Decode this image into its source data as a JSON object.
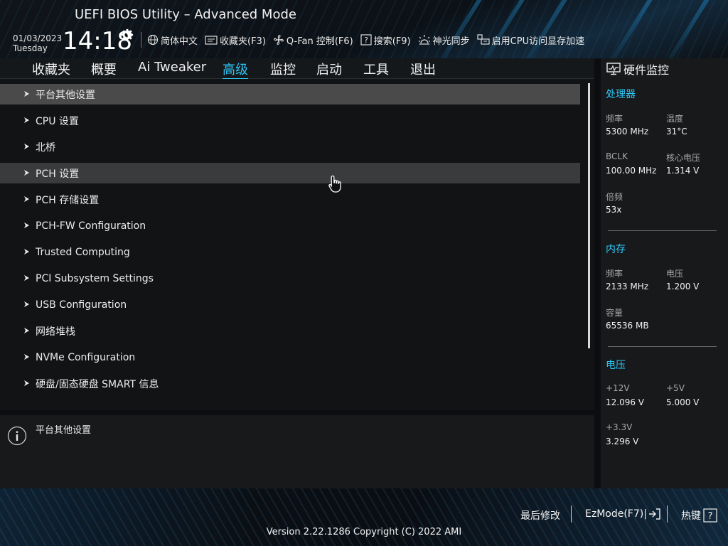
{
  "header": {
    "title": "UEFI BIOS Utility – Advanced Mode",
    "date": "01/03/2023",
    "weekday": "Tuesday",
    "time": "14:18",
    "toolbar": [
      {
        "label": "简体中文",
        "icon": "globe-icon"
      },
      {
        "label": "收藏夹(F3)",
        "icon": "favorites-icon"
      },
      {
        "label": "Q-Fan 控制(F6)",
        "icon": "fan-icon"
      },
      {
        "label": "搜索(F9)",
        "icon": "help-search-icon"
      },
      {
        "label": "神光同步",
        "icon": "aura-icon"
      },
      {
        "label": "启用CPU访问显存加速",
        "icon": "resize-bar-icon"
      }
    ]
  },
  "tabs": [
    {
      "label": "收藏夹",
      "active": false
    },
    {
      "label": "概要",
      "active": false
    },
    {
      "label": "Ai Tweaker",
      "active": false
    },
    {
      "label": "高级",
      "active": true
    },
    {
      "label": "监控",
      "active": false
    },
    {
      "label": "启动",
      "active": false
    },
    {
      "label": "工具",
      "active": false
    },
    {
      "label": "退出",
      "active": false
    }
  ],
  "menu": {
    "items": [
      {
        "label": "平台其他设置"
      },
      {
        "label": "CPU 设置"
      },
      {
        "label": "北桥"
      },
      {
        "label": "PCH 设置"
      },
      {
        "label": "PCH 存储设置"
      },
      {
        "label": "PCH-FW Configuration"
      },
      {
        "label": "Trusted Computing"
      },
      {
        "label": "PCI Subsystem Settings"
      },
      {
        "label": "USB Configuration"
      },
      {
        "label": "网络堆栈"
      },
      {
        "label": "NVMe Configuration"
      },
      {
        "label": "硬盘/固态硬盘 SMART 信息"
      }
    ],
    "selected_index": 0,
    "hover_index": 3
  },
  "help": {
    "text": "平台其他设置"
  },
  "hw_monitor": {
    "title": "硬件监控",
    "cpu": {
      "section": "处理器",
      "freq_label": "频率",
      "freq": "5300 MHz",
      "temp_label": "温度",
      "temp": "31°C",
      "bclk_label": "BCLK",
      "bclk": "100.00 MHz",
      "vcore_label": "核心电压",
      "vcore": "1.314 V",
      "ratio_label": "倍频",
      "ratio": "53x"
    },
    "memory": {
      "section": "内存",
      "freq_label": "频率",
      "freq": "2133 MHz",
      "volt_label": "电压",
      "volt": "1.200 V",
      "cap_label": "容量",
      "cap": "65536 MB"
    },
    "voltage": {
      "section": "电压",
      "v12_label": "+12V",
      "v12": "12.096 V",
      "v5_label": "+5V",
      "v5": "5.000 V",
      "v33_label": "+3.3V",
      "v33": "3.296 V"
    }
  },
  "footer": {
    "last_modified": "最后修改",
    "ezmode": "EzMode(F7)|",
    "hotkeys": "热键",
    "version": "Version 2.22.1286 Copyright (C) 2022 AMI"
  },
  "colors": {
    "accent": "#2fc6f6",
    "selected_row": "#4a4a4a",
    "hover_row": "#3a3b3c"
  }
}
